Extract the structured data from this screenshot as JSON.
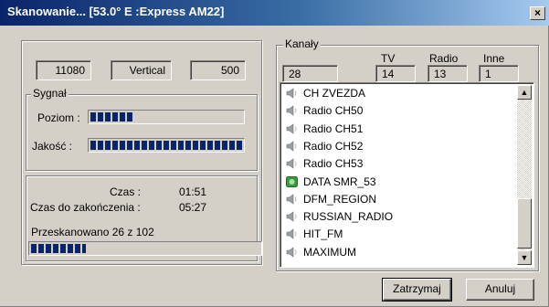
{
  "window": {
    "title": "Skanowanie... [53.0° E :Express AM22]",
    "close_symbol": "×"
  },
  "tuning": {
    "frequency": "11080",
    "polarization": "Vertical",
    "symbol_rate": "500"
  },
  "signal": {
    "group_label": "Sygnał",
    "level_label": "Poziom :",
    "level_percent": 30,
    "quality_label": "Jakość :",
    "quality_percent": 100
  },
  "progress": {
    "time_label": "Czas :",
    "time_value": "01:51",
    "remaining_label": "Czas do zakończenia :",
    "remaining_value": "05:27",
    "scanned_text": "Przeskanowano 26 z 102",
    "percent": 25
  },
  "channels": {
    "group_label": "Kanały",
    "col_tv": "TV",
    "col_radio": "Radio",
    "col_other": "Inne",
    "total": "28",
    "tv": "14",
    "radio": "13",
    "other": "1",
    "items": [
      {
        "name": "CH ZVEZDA",
        "icon": "radio-speaker-icon"
      },
      {
        "name": "Radio CH50",
        "icon": "radio-speaker-icon"
      },
      {
        "name": "Radio CH51",
        "icon": "radio-speaker-icon"
      },
      {
        "name": "Radio CH52",
        "icon": "radio-speaker-icon"
      },
      {
        "name": "Radio CH53",
        "icon": "radio-speaker-icon"
      },
      {
        "name": "DATA SMR_53",
        "icon": "data-channel-icon"
      },
      {
        "name": "DFM_REGION",
        "icon": "radio-speaker-icon"
      },
      {
        "name": "RUSSIAN_RADIO",
        "icon": "radio-speaker-icon"
      },
      {
        "name": "HIT_FM",
        "icon": "radio-speaker-icon"
      },
      {
        "name": "MAXIMUM",
        "icon": "radio-speaker-icon"
      }
    ]
  },
  "buttons": {
    "stop": "Zatrzymaj",
    "cancel": "Anuluj"
  },
  "colors": {
    "title_bar": "#0a246a",
    "progress": "#0a246a",
    "face": "#d4d0c8"
  }
}
